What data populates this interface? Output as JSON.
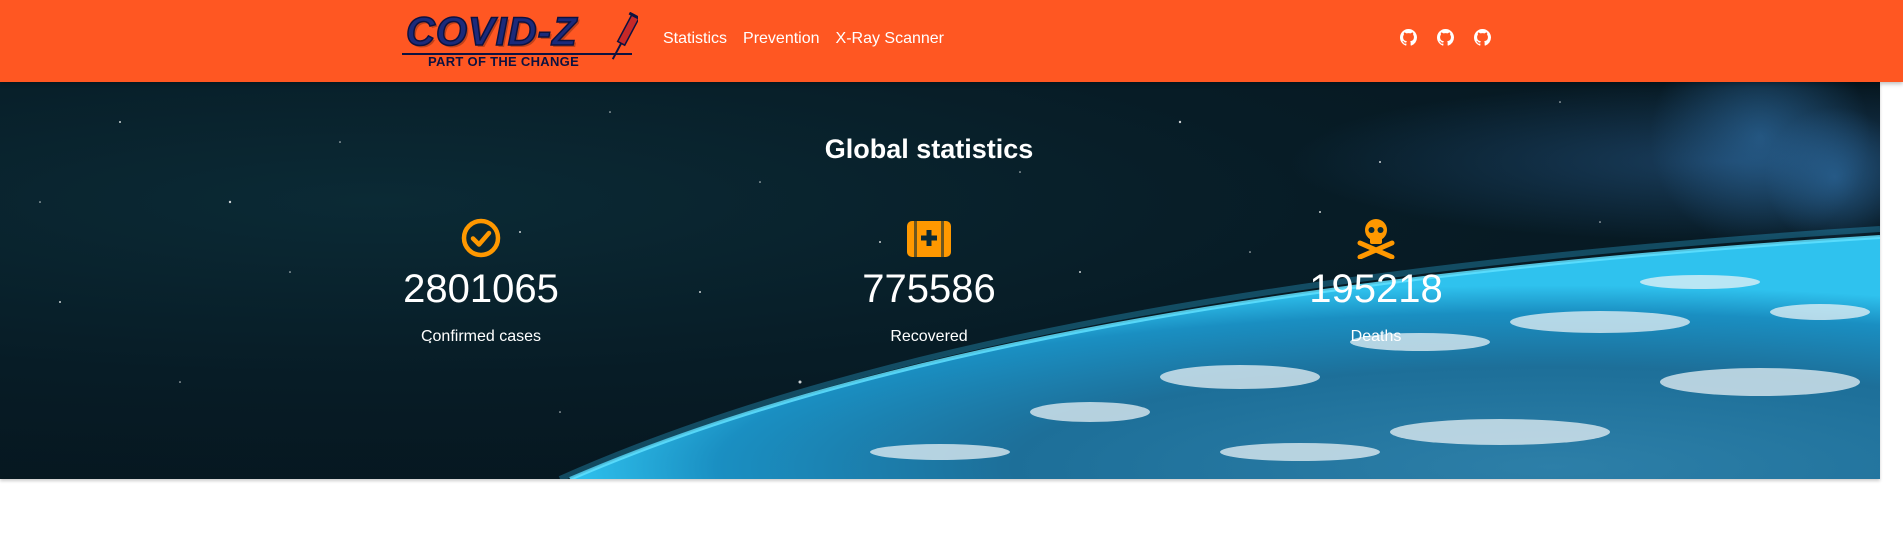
{
  "brand": {
    "name": "COVID-Z",
    "tagline": "PART OF THE CHANGE"
  },
  "nav": {
    "links": [
      {
        "label": "Statistics"
      },
      {
        "label": "Prevention"
      },
      {
        "label": "X-Ray Scanner"
      }
    ],
    "icons": [
      "github-icon",
      "github-icon",
      "github-icon"
    ]
  },
  "hero": {
    "title": "Global statistics",
    "stats": [
      {
        "icon": "check-circle-icon",
        "value": "2801065",
        "label": "Confirmed cases"
      },
      {
        "icon": "medkit-icon",
        "value": "775586",
        "label": "Recovered"
      },
      {
        "icon": "skull-crossbones-icon",
        "value": "195218",
        "label": "Deaths"
      }
    ]
  },
  "colors": {
    "navbar": "#ff5722",
    "accent_icon": "#ff9800",
    "logo_text": "#1c2a7a",
    "text": "#ffffff"
  }
}
